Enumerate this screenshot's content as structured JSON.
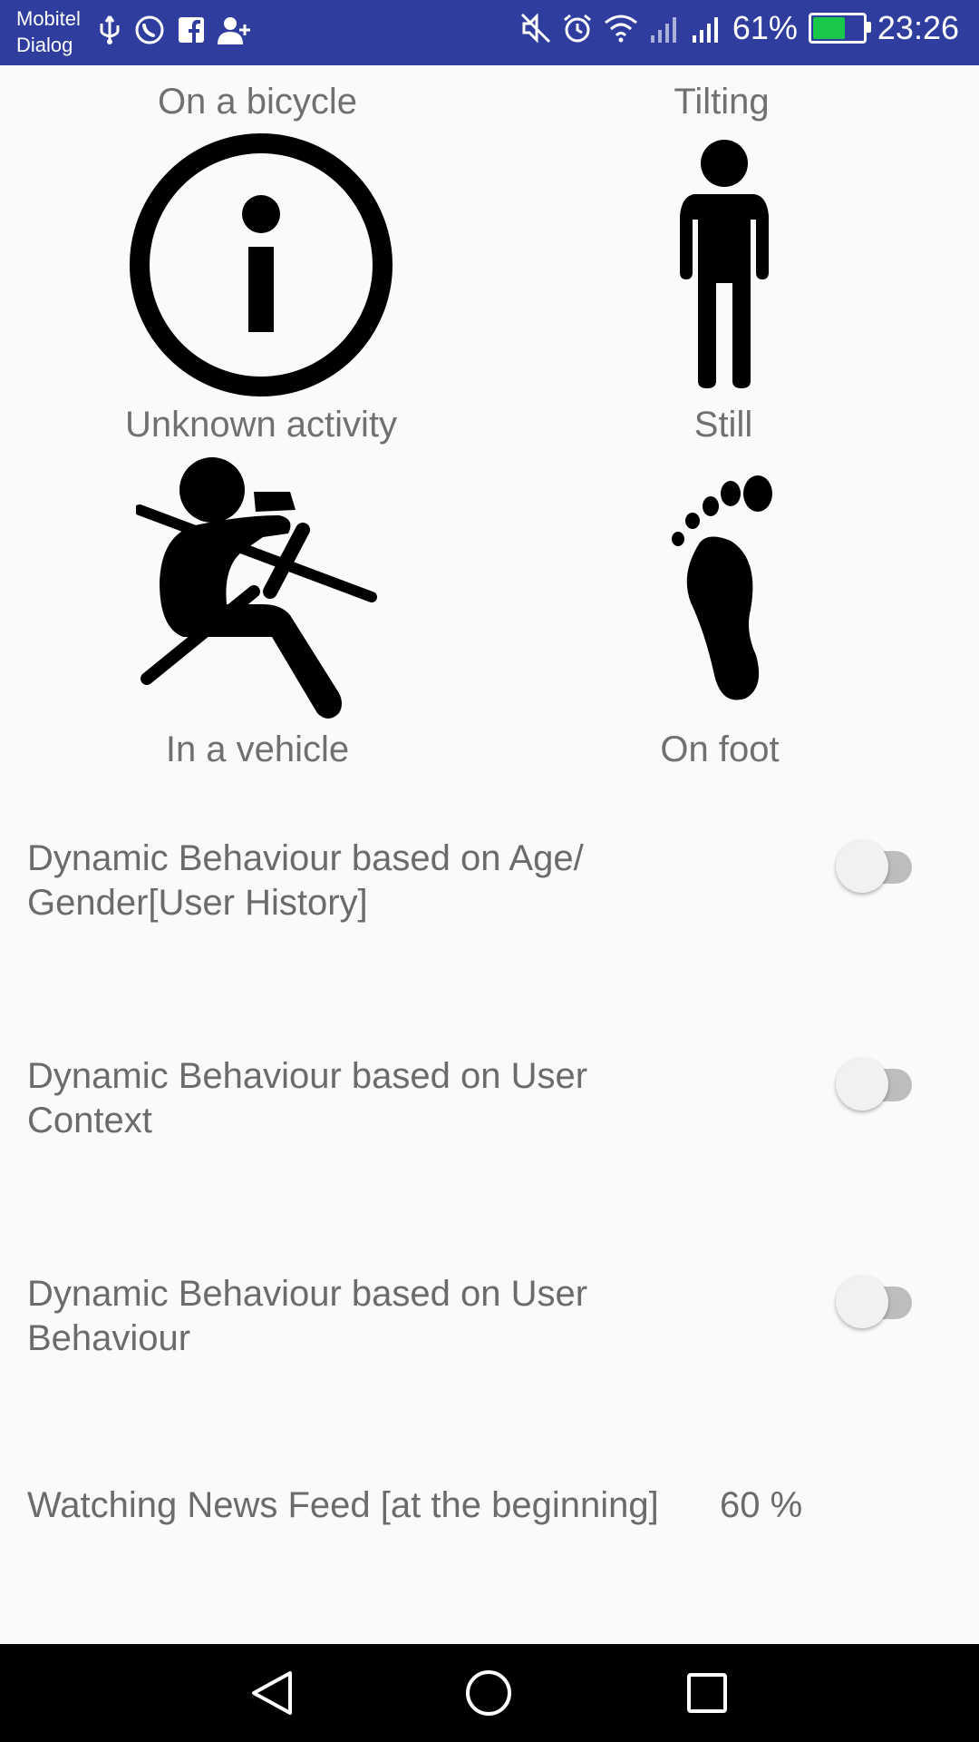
{
  "status_bar": {
    "carrier_line1": "Mobitel",
    "carrier_line2": "Dialog",
    "battery_percent": "61%",
    "battery_level": 0.61,
    "time": "23:26",
    "left_icons": [
      "usb-icon",
      "whatsapp-icon",
      "facebook-icon",
      "add-contact-icon"
    ],
    "right_icons": [
      "mute-icon",
      "alarm-icon",
      "wifi-icon",
      "signal-icon",
      "signal-icon",
      "battery-icon"
    ],
    "battery_color": "#19c84a",
    "background": "#2f3e9e"
  },
  "activities": {
    "top_left_label": "On a bicycle",
    "top_right_label": "Tilting",
    "items": [
      {
        "label": "Unknown activity",
        "icon": "info-icon"
      },
      {
        "label": "Still",
        "icon": "person-standing-icon"
      },
      {
        "label": "In a vehicle",
        "icon": "seatbelt-passenger-icon"
      },
      {
        "label": "On foot",
        "icon": "footprint-icon"
      }
    ]
  },
  "settings": [
    {
      "line1": "Dynamic Behaviour based on Age/",
      "line2": "Gender[User History]",
      "enabled": false
    },
    {
      "line1": "Dynamic Behaviour based on User",
      "line2": "Context",
      "enabled": false
    },
    {
      "line1": "Dynamic Behaviour based on User",
      "line2": "Behaviour",
      "enabled": false
    }
  ],
  "news_feed": {
    "label": "Watching News Feed [at the beginning]",
    "value": "60 %"
  },
  "nav": [
    "back-icon",
    "home-icon",
    "recents-icon"
  ]
}
